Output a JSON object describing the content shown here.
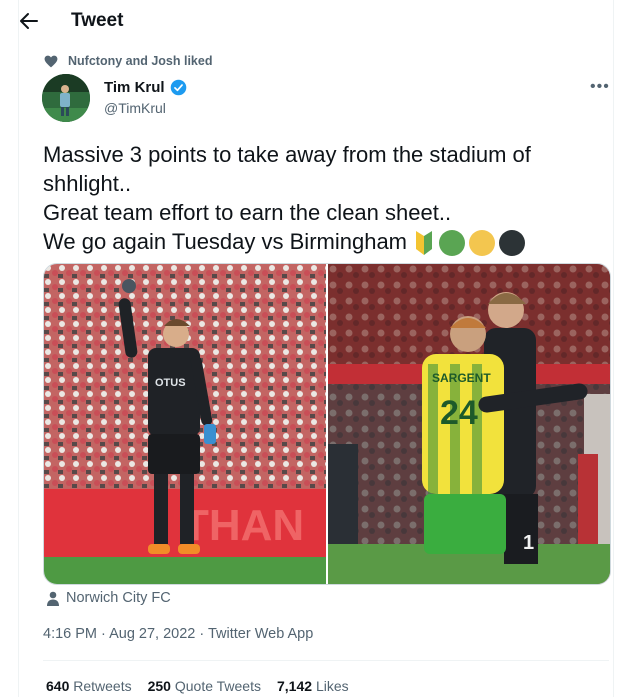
{
  "header": {
    "title": "Tweet"
  },
  "social_context": {
    "text": "Nufctony and Josh liked"
  },
  "author": {
    "name": "Tim Krul",
    "handle": "@TimKrul"
  },
  "tweet": {
    "lines": [
      "Massive 3 points to take away from the stadium of",
      "shhlight..",
      "Great team effort to earn the clean sheet..",
      "We go again Tuesday vs Birmingham"
    ],
    "emoji_colors": [
      "#9fc437",
      "#5aa553",
      "#f3c64f",
      "#2c3336"
    ]
  },
  "media": {
    "photo1": {
      "board_text": "THAN",
      "shirt_text": "OTUS"
    },
    "photo2": {
      "shirt_name": "SARGENT",
      "shirt_number": "24",
      "gk_number": "1"
    }
  },
  "location": "Norwich City FC",
  "meta": "4:16 PM · Aug 27, 2022 · Twitter Web App",
  "stats": {
    "retweets": {
      "count": "640",
      "label": "Retweets"
    },
    "quotes": {
      "count": "250",
      "label": "Quote Tweets"
    },
    "likes": {
      "count": "7,142",
      "label": "Likes"
    }
  },
  "colors": {
    "text": "#0f1419",
    "secondary": "#536471",
    "verified": "#1d9bf0"
  }
}
